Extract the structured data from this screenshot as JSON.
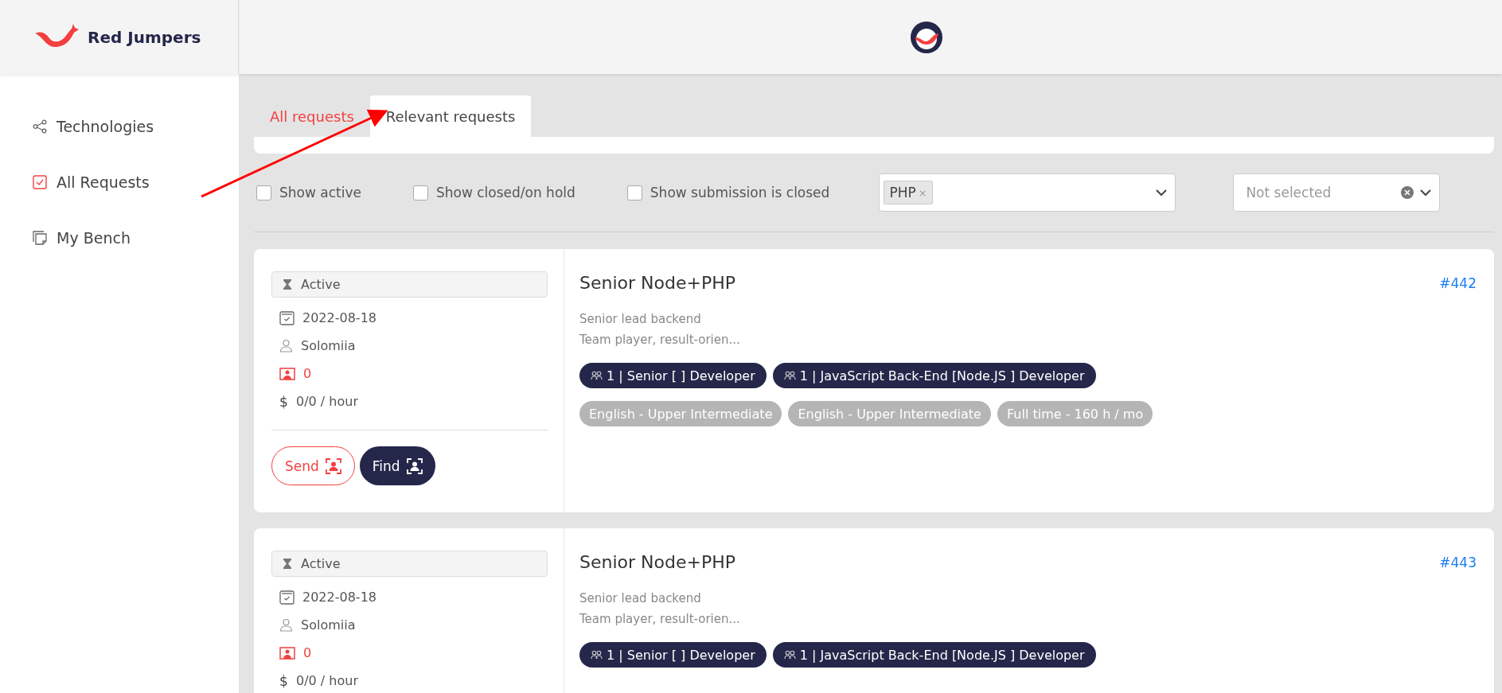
{
  "header": {
    "brand": "Red Jumpers"
  },
  "sidebar": {
    "items": [
      {
        "label": "Technologies",
        "kind": "share",
        "selected": false
      },
      {
        "label": "All Requests",
        "kind": "checkbox",
        "selected": true
      },
      {
        "label": "My Bench",
        "kind": "notes",
        "selected": false
      }
    ]
  },
  "tabs": [
    {
      "label": "All requests",
      "selected": false
    },
    {
      "label": "Relevant requests",
      "selected": true
    }
  ],
  "filters": {
    "checkboxes": [
      {
        "label": "Show active",
        "checked": false
      },
      {
        "label": "Show closed/on hold",
        "checked": false
      },
      {
        "label": "Show submission is closed",
        "checked": false
      }
    ],
    "technology_select": {
      "chips": [
        {
          "label": "PHP",
          "remove": "×"
        }
      ]
    },
    "second_select": {
      "placeholder": "Not selected"
    }
  },
  "requests": [
    {
      "status": "Active",
      "date": "2022-08-18",
      "owner": "Solomiia",
      "candidates": "0",
      "currency": "$",
      "rate": "0/0 / hour",
      "title": "Senior Node+PHP",
      "id": "#442",
      "description": [
        "Senior lead backend",
        "Team player, result-orien..."
      ],
      "roles": [
        "1 | Senior [ ] Developer",
        "1 | JavaScript Back-End [Node.JS ] Developer"
      ],
      "requirements": [
        "English - Upper Intermediate",
        "English - Upper Intermediate",
        "Full time - 160 h / mo"
      ],
      "buttons": {
        "send": "Send",
        "find": "Find"
      }
    },
    {
      "status": "Active",
      "date": "2022-08-18",
      "owner": "Solomiia",
      "candidates": "0",
      "currency": "$",
      "rate": "0/0 / hour",
      "title": "Senior Node+PHP",
      "id": "#443",
      "description": [
        "Senior lead backend",
        "Team player, result-orien..."
      ],
      "roles": [
        "1 | Senior [ ] Developer",
        "1 | JavaScript Back-End [Node.JS ] Developer"
      ]
    }
  ]
}
